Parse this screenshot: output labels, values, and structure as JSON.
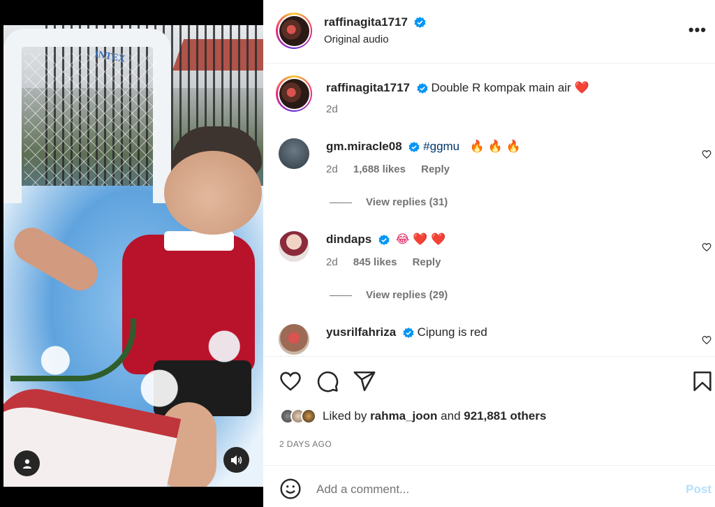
{
  "media": {
    "scene_watermark": "INTEX"
  },
  "header": {
    "username": "raffinagita1717",
    "subtitle": "Original audio",
    "more_label": "•••"
  },
  "caption": {
    "username": "raffinagita1717",
    "text": "Double R kompak main air",
    "emoji": "❤️",
    "age": "2d"
  },
  "comments": [
    {
      "username": "gm.miracle08",
      "hashtag": "#ggmu",
      "emoji": "🔥 🔥 🔥",
      "age": "2d",
      "likes": "1,688 likes",
      "reply": "Reply",
      "view_replies": "View replies (31)"
    },
    {
      "username": "dindaps",
      "emoji": "😂 ❤️ ❤️",
      "age": "2d",
      "likes": "845 likes",
      "reply": "Reply",
      "view_replies": "View replies (29)"
    },
    {
      "username": "yusrilfahriza",
      "text": "Cipung is red"
    }
  ],
  "likes": {
    "prefix": "Liked by",
    "user": "rahma_joon",
    "middle": "and",
    "count": "921,881 others"
  },
  "timestamp": "2 DAYS AGO",
  "add_comment": {
    "placeholder": "Add a comment...",
    "post_label": "Post"
  },
  "colors": {
    "verified": "#0095f6",
    "link": "#00376b",
    "muted": "#737373",
    "post_disabled": "#b2dffc"
  }
}
